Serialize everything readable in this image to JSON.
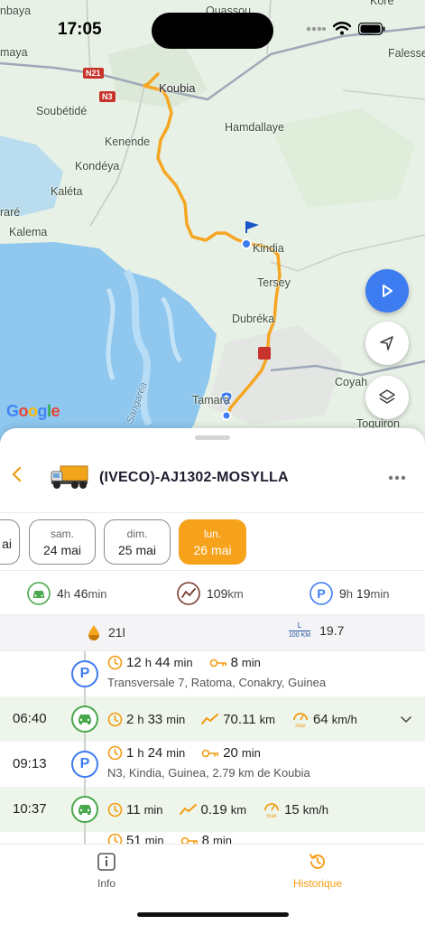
{
  "status_bar": {
    "time": "17:05"
  },
  "map": {
    "labels": {
      "quassou": "Quassou",
      "kore": "Koré",
      "falessa": "Falesse",
      "nbaya": "nbaya",
      "maya": "maya",
      "koubia": "Koubia",
      "soubetide": "Soubétidé",
      "kenende": "Kenende",
      "hamdallaye": "Hamdallaye",
      "kondeya": "Kondéya",
      "kaleta": "Kaléta",
      "rare": "raré",
      "kalema": "Kalema",
      "kindia": "Kindia",
      "tersey": "Tersey",
      "dubreka": "Dubréka",
      "coyah": "Coyah",
      "tamara": "Tamara",
      "toguiron": "Toguiron",
      "sangarea": "Sangaréa"
    },
    "road_signs": {
      "n21": "N21",
      "n3": "N3"
    },
    "attribution": [
      "G",
      "o",
      "o",
      "g",
      "l",
      "e"
    ]
  },
  "vehicle": {
    "name": "(IVECO)-AJ1302-MOSYLLA"
  },
  "dates": [
    {
      "day": "",
      "date": "ai"
    },
    {
      "day": "sam.",
      "date": "24 mai"
    },
    {
      "day": "dim.",
      "date": "25 mai"
    },
    {
      "day": "lun.",
      "date": "26 mai",
      "active": true
    }
  ],
  "summary": {
    "driving_h": "4",
    "driving_h_unit": "h",
    "driving_min": "46",
    "driving_min_unit": "min",
    "distance": "109",
    "distance_unit": "km",
    "parking_h": "9",
    "parking_h_unit": "h",
    "parking_min": "19",
    "parking_min_unit": "min",
    "fuel": "21",
    "fuel_unit": "l",
    "consumption_top": "L",
    "consumption_bottom": "100 KM",
    "consumption": "19.7"
  },
  "timeline": [
    {
      "type": "park",
      "time": "",
      "dur_h": "12",
      "dur_min": "44",
      "idle": "8",
      "address": "Transversale 7, Ratoma, Conakry, Guinea"
    },
    {
      "type": "drive",
      "time": "06:40",
      "dur_h": "2",
      "dur_min": "33",
      "distance": "70.11",
      "max_speed": "64"
    },
    {
      "type": "park",
      "time": "09:13",
      "dur_h": "1",
      "dur_min": "24",
      "idle": "20",
      "address": "N3, Kindia, Guinea, 2.79 km de Koubia"
    },
    {
      "type": "drive",
      "time": "10:37",
      "dur_h": "",
      "dur_min": "11",
      "distance": "0.19",
      "max_speed": "15"
    },
    {
      "type": "park",
      "time": "",
      "dur_h": "",
      "dur_min": "51",
      "idle": "8",
      "address": ""
    }
  ],
  "units": {
    "h": "h",
    "min": "min",
    "km": "km",
    "kmh": "km/h",
    "max": "max"
  },
  "nav": {
    "info_label": "Info",
    "history_label": "Historique"
  },
  "colors": {
    "accent": "#f7a21b",
    "parking_blue": "#3d7bf0",
    "driving_green": "#49a84c",
    "route_orange": "#f5a623"
  }
}
